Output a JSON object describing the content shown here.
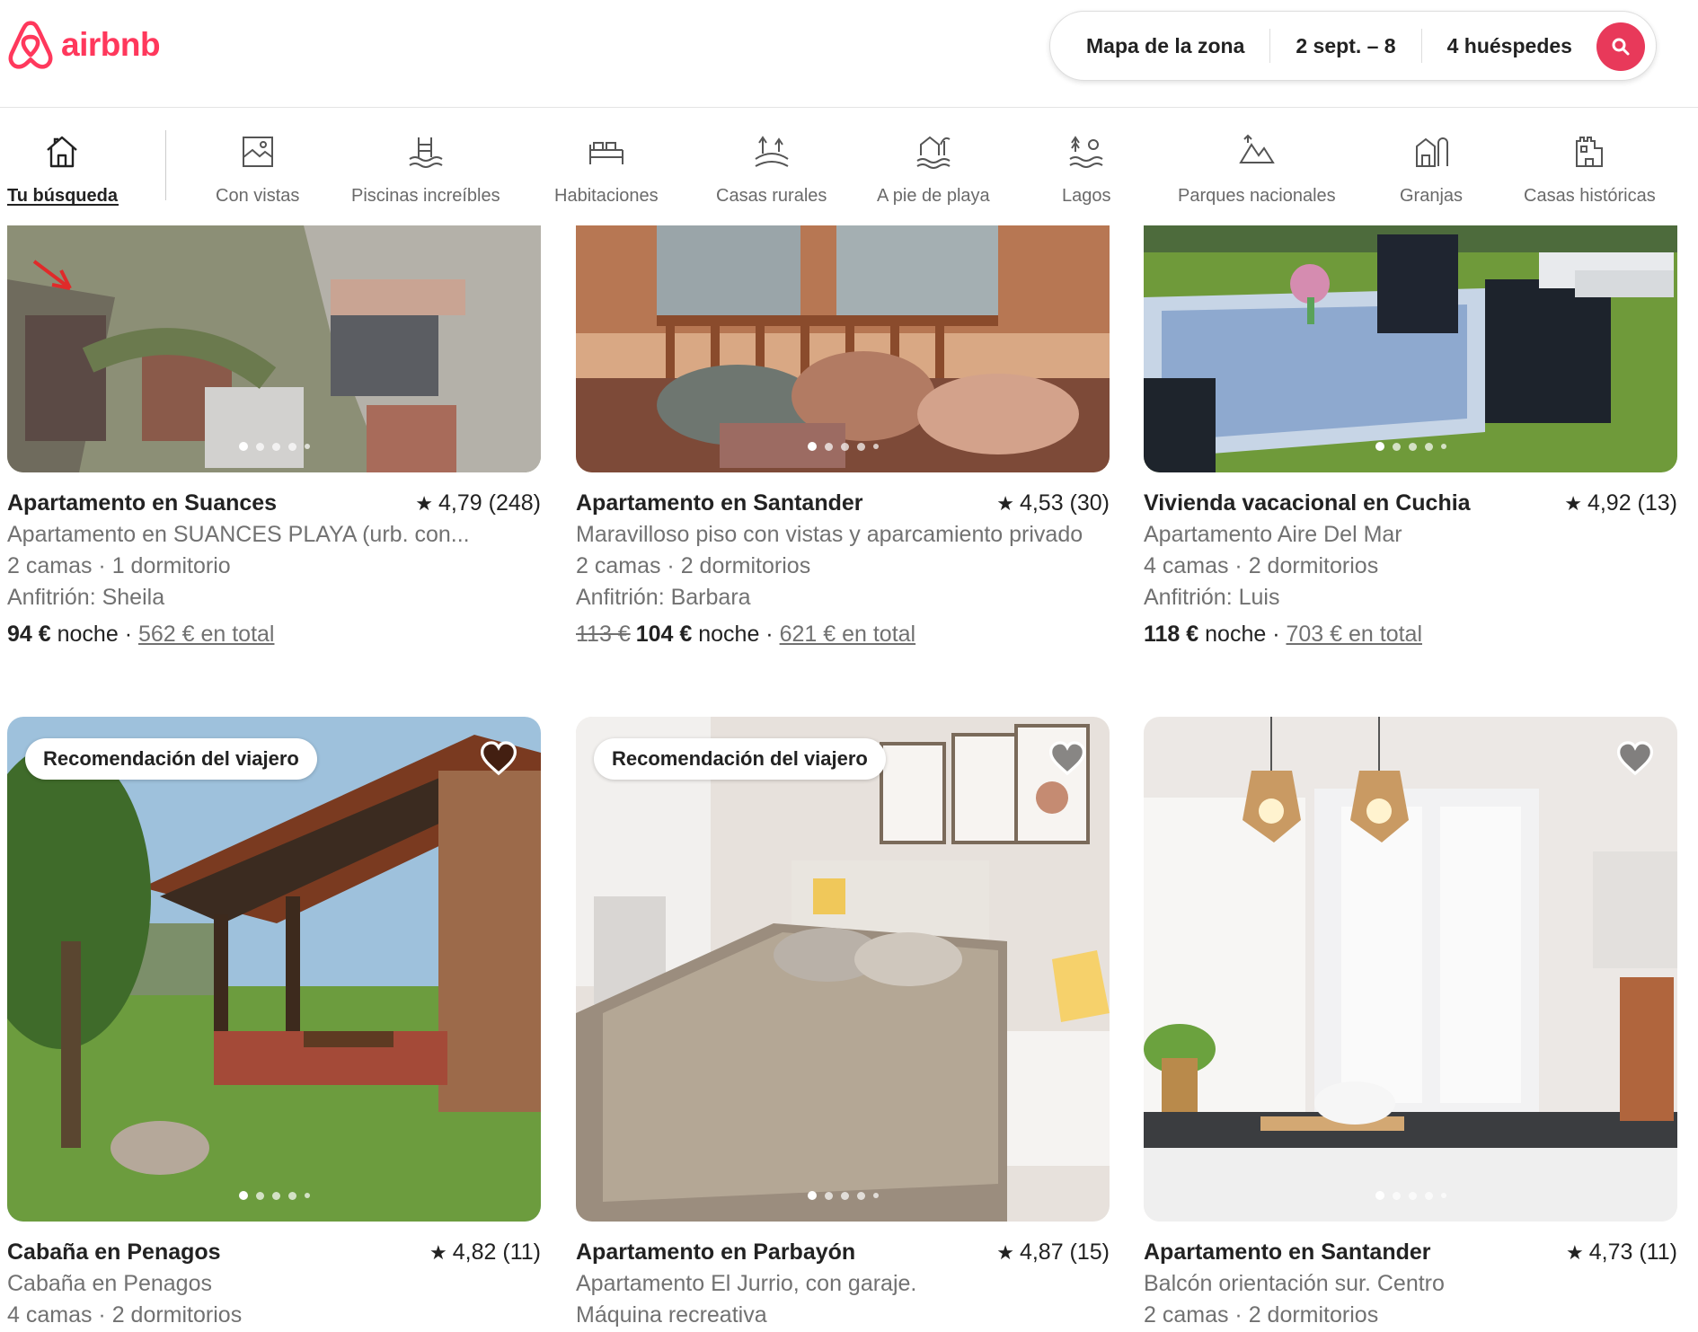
{
  "brand": {
    "name": "airbnb",
    "color": "#FF385C"
  },
  "search": {
    "location": "Mapa de la zona",
    "dates": "2 sept. – 8",
    "guests": "4 huéspedes",
    "button_icon": "search-icon"
  },
  "categories": [
    {
      "label": "Tu búsqueda",
      "icon": "house-icon",
      "active": true
    },
    {
      "label": "Con vistas",
      "icon": "view-icon"
    },
    {
      "label": "Piscinas increíbles",
      "icon": "pool-icon"
    },
    {
      "label": "Habitaciones",
      "icon": "bed-icon"
    },
    {
      "label": "Casas rurales",
      "icon": "countryside-icon"
    },
    {
      "label": "A pie de playa",
      "icon": "beachfront-icon"
    },
    {
      "label": "Lagos",
      "icon": "lake-icon"
    },
    {
      "label": "Parques nacionales",
      "icon": "national-park-icon"
    },
    {
      "label": "Granjas",
      "icon": "farm-icon"
    },
    {
      "label": "Casas históricas",
      "icon": "historic-home-icon"
    }
  ],
  "listings": [
    {
      "title": "Apartamento en Suances",
      "rating": "4,79 (248)",
      "description": "Apartamento en SUANCES PLAYA (urb. con...",
      "beds": "2 camas · 1 dormitorio",
      "host": "Anfitrión: Sheila",
      "price": "94 €",
      "price_unit": "noche",
      "total": "562 € en total"
    },
    {
      "title": "Apartamento en Santander",
      "rating": "4,53 (30)",
      "description": "Maravilloso piso con vistas y aparcamiento privado",
      "beds": "2 camas · 2 dormitorios",
      "host": "Anfitrión: Barbara",
      "old_price": "113 €",
      "price": "104 €",
      "price_unit": "noche",
      "total": "621 € en total"
    },
    {
      "title": "Vivienda vacacional en Cuchia",
      "rating": "4,92 (13)",
      "description": "Apartamento Aire Del Mar",
      "beds": "4 camas · 2 dormitorios",
      "host": "Anfitrión: Luis",
      "price": "118 €",
      "price_unit": "noche",
      "total": "703 € en total"
    },
    {
      "badge": "Recomendación del viajero",
      "title": "Cabaña en Penagos",
      "rating": "4,82 (11)",
      "description": "Cabaña en Penagos",
      "beds": "4 camas · 2 dormitorios"
    },
    {
      "badge": "Recomendación del viajero",
      "title": "Apartamento en Parbayón",
      "rating": "4,87 (15)",
      "description": "Apartamento El Jurrio, con garaje.",
      "beds": "Máquina recreativa"
    },
    {
      "title": "Apartamento en Santander",
      "rating": "4,73 (11)",
      "description": "Balcón orientación sur. Centro",
      "beds": "2 camas · 2 dormitorios"
    }
  ]
}
